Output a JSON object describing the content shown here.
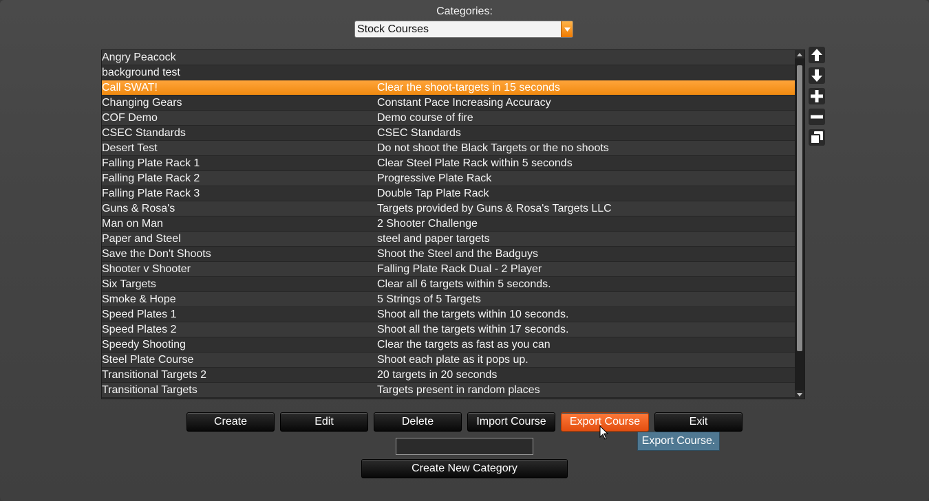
{
  "categories": {
    "label": "Categories:",
    "selected": "Stock Courses"
  },
  "courses": [
    {
      "name": "Angry Peacock",
      "desc": ""
    },
    {
      "name": "background test",
      "desc": ""
    },
    {
      "name": "Call SWAT!",
      "desc": "Clear the shoot-targets in 15 seconds",
      "selected": true
    },
    {
      "name": "Changing Gears",
      "desc": "Constant Pace Increasing Accuracy"
    },
    {
      "name": "COF Demo",
      "desc": "Demo course of fire"
    },
    {
      "name": "CSEC Standards",
      "desc": "CSEC Standards"
    },
    {
      "name": "Desert Test",
      "desc": "Do not shoot the Black Targets or the no shoots"
    },
    {
      "name": "Falling Plate Rack 1",
      "desc": "Clear Steel Plate Rack within 5 seconds"
    },
    {
      "name": "Falling Plate Rack 2",
      "desc": "Progressive Plate Rack"
    },
    {
      "name": "Falling Plate Rack 3",
      "desc": "Double Tap Plate Rack"
    },
    {
      "name": "Guns & Rosa's",
      "desc": "Targets provided by Guns & Rosa's Targets LLC"
    },
    {
      "name": "Man on Man",
      "desc": "2 Shooter Challenge"
    },
    {
      "name": "Paper and Steel",
      "desc": "steel and paper targets"
    },
    {
      "name": "Save the Don't Shoots",
      "desc": "Shoot the Steel and the Badguys"
    },
    {
      "name": "Shooter v Shooter",
      "desc": "Falling Plate Rack Dual - 2 Player"
    },
    {
      "name": "Six Targets",
      "desc": "Clear all 6 targets within 5 seconds."
    },
    {
      "name": "Smoke & Hope",
      "desc": "5 Strings of 5 Targets"
    },
    {
      "name": "Speed Plates 1",
      "desc": "Shoot all the targets within 10 seconds."
    },
    {
      "name": "Speed Plates 2",
      "desc": "Shoot all the targets within 17 seconds."
    },
    {
      "name": "Speedy Shooting",
      "desc": "Clear the targets as fast as you can"
    },
    {
      "name": "Steel Plate Course",
      "desc": "Shoot each plate as it pops up."
    },
    {
      "name": "Transitional Targets 2",
      "desc": "20 targets in 20 seconds"
    },
    {
      "name": "Transitional Targets",
      "desc": "Targets present in random places"
    }
  ],
  "side_tools": [
    {
      "icon": "arrow-up-icon"
    },
    {
      "icon": "arrow-down-icon"
    },
    {
      "icon": "plus-icon"
    },
    {
      "icon": "minus-icon"
    },
    {
      "icon": "copy-icon"
    }
  ],
  "buttons": {
    "create": "Create",
    "edit": "Edit",
    "delete": "Delete",
    "import": "Import Course",
    "export": "Export Course",
    "exit": "Exit"
  },
  "tooltip": "Export Course.",
  "new_category": {
    "value": "",
    "button": "Create New Category"
  },
  "colors": {
    "accent": "#f08a10",
    "active_button": "#e24e10",
    "tooltip_bg": "#4f7892"
  }
}
